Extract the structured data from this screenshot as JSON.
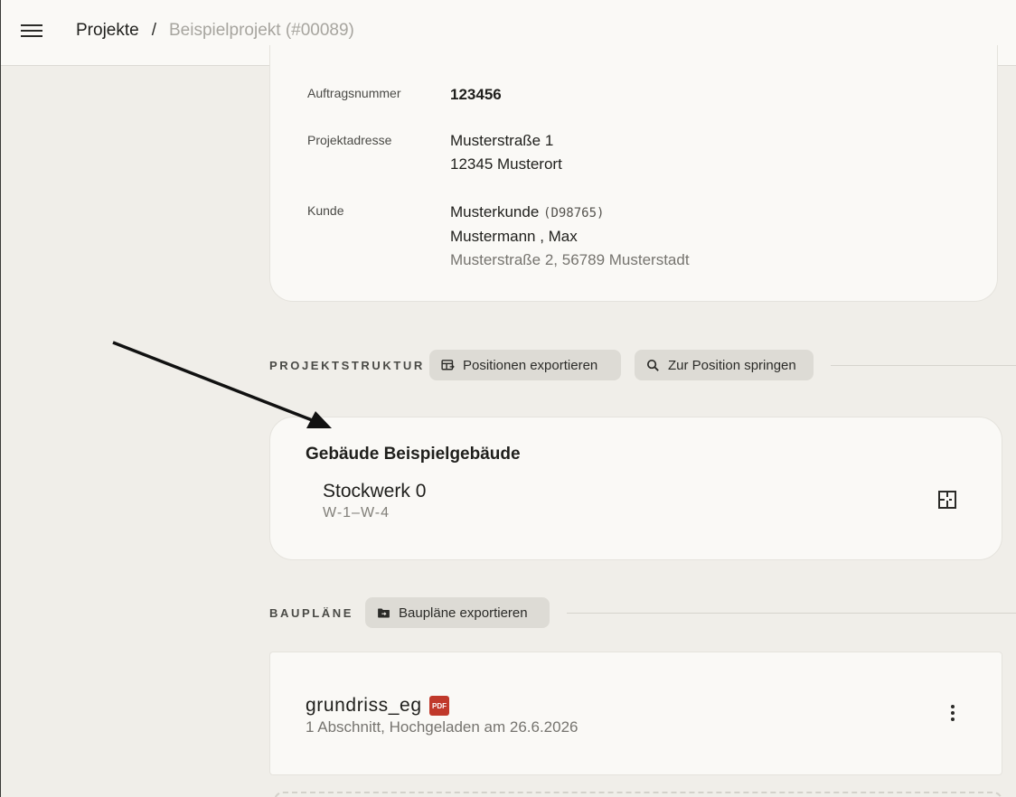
{
  "breadcrumb": {
    "root": "Projekte",
    "separator": "/",
    "current": "Beispielprojekt (#00089)"
  },
  "info": {
    "order_label": "Auftragsnummer",
    "order_value": "123456",
    "address_label": "Projektadresse",
    "address_line1": "Musterstraße 1",
    "address_line2": "12345 Musterort",
    "customer_label": "Kunde",
    "customer_name": "Musterkunde",
    "customer_id": "(D98765)",
    "customer_contact": "Mustermann , Max",
    "customer_address": "Musterstraße 2, 56789 Musterstadt"
  },
  "structure": {
    "section_label": "PROJEKTSTRUKTUR",
    "export_button": "Positionen exportieren",
    "jump_button": "Zur Position springen",
    "building_title": "Gebäude Beispielgebäude",
    "floor_title": "Stockwerk 0",
    "floor_range": "W-1–W-4"
  },
  "plans": {
    "section_label": "BAUPLÄNE",
    "export_button": "Baupläne exportieren",
    "file_name": "grundriss_eg",
    "file_badge": "PDF",
    "file_meta": "1 Abschnitt, Hochgeladen am 26.6.2026"
  },
  "icons": {
    "menu": "hamburger-icon",
    "table_export": "table-export-icon",
    "search": "search-icon",
    "floorplan": "floorplan-icon",
    "folder_export": "folder-export-icon",
    "more": "more-vert-icon"
  },
  "colors": {
    "background": "#f0eee9",
    "card": "#faf9f6",
    "chip": "#dddbd5",
    "pdf": "#c0392b"
  }
}
